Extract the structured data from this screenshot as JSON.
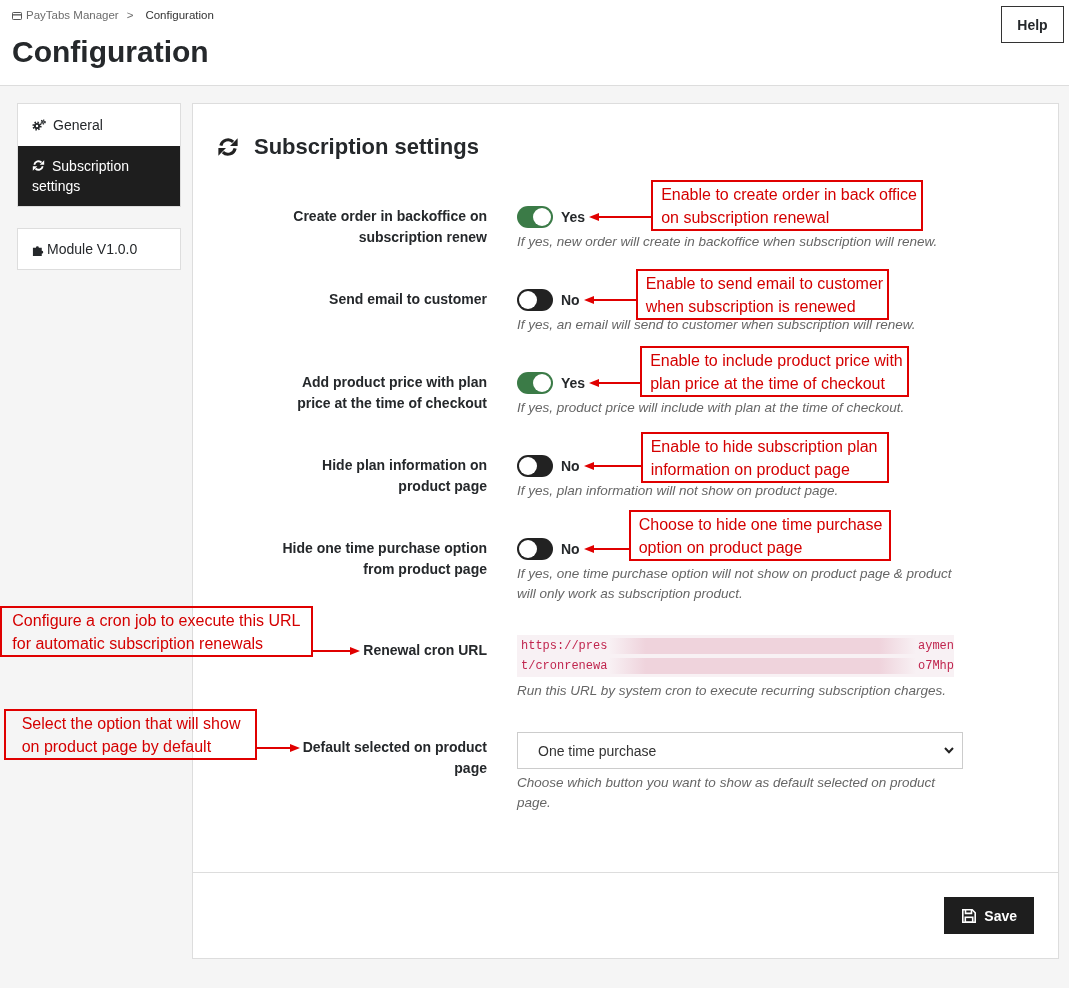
{
  "header": {
    "breadcrumb": {
      "items": [
        "PayTabs Manager",
        "Configuration"
      ],
      "separator": ">"
    },
    "title": "Configuration",
    "help_button": "Help"
  },
  "sidebar": {
    "menu": [
      {
        "label": "General",
        "selected": false
      },
      {
        "label": "Subscription settings",
        "selected": true
      }
    ],
    "module": "Module V1.0.0"
  },
  "panel": {
    "title": "Subscription settings",
    "settings": [
      {
        "kind": "toggle",
        "label": "Create order in backoffice on subscription renew",
        "on": true,
        "state_label": "Yes",
        "help": "If yes, new order will create in backoffice when subscription will renew.",
        "annotation": "Enable to create order in back office on subscription renewal"
      },
      {
        "kind": "toggle",
        "label": "Send email to customer",
        "on": false,
        "state_label": "No",
        "help": "If yes, an email will send to customer when subscription will renew.",
        "annotation": "Enable to send email to customer when subscription is renewed"
      },
      {
        "kind": "toggle",
        "label": "Add product price with plan price at the time of checkout",
        "on": true,
        "state_label": "Yes",
        "help": "If yes, product price will include with plan at the time of checkout.",
        "annotation": "Enable to include product price with plan price at the time of checkout"
      },
      {
        "kind": "toggle",
        "label": "Hide plan information on product page",
        "on": false,
        "state_label": "No",
        "help": "If yes, plan information will not show on product page.",
        "annotation": "Enable to hide subscription plan information on product page"
      },
      {
        "kind": "toggle",
        "label": "Hide one time purchase option from product page",
        "on": false,
        "state_label": "No",
        "help": "If yes, one time purchase option will not show on product page & product will only work as subscription product.",
        "annotation": "Choose to hide one time purchase option on product page"
      },
      {
        "kind": "code",
        "label": "Renewal cron URL",
        "lines": [
          {
            "start": "https://pres",
            "end": "aymen"
          },
          {
            "start": "t/cronrenewa",
            "end": "o7Mhp"
          }
        ],
        "help": "Run this URL by system cron to execute recurring subscription charges.",
        "annotation": "Configure a cron job to execute this URL for automatic subscription renewals"
      },
      {
        "kind": "select",
        "label": "Default selected on product page",
        "value": "One time purchase",
        "help": "Choose which button you want to show as default selected on product page.",
        "annotation": "Select the option that will show on product page by default"
      }
    ],
    "save_button": "Save"
  }
}
